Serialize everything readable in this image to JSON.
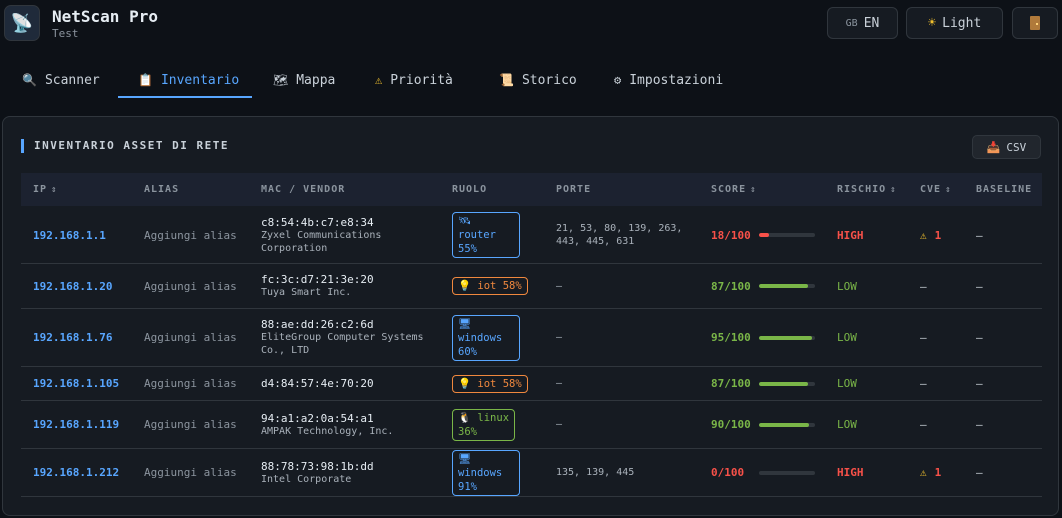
{
  "app": {
    "title": "NetScan Pro",
    "subtitle": "Test",
    "logo_icon": "satellite-dish-icon"
  },
  "header_buttons": {
    "lang_flag": "GB",
    "lang_label": "EN",
    "theme_label": "Light",
    "exit_icon": "door-icon"
  },
  "tabs": [
    {
      "label": "Scanner",
      "icon": "🔍"
    },
    {
      "label": "Inventario",
      "icon": "📋",
      "active": true
    },
    {
      "label": "Mappa",
      "icon": "🗺"
    },
    {
      "label": "Priorità",
      "icon": "⚠"
    },
    {
      "label": "Storico",
      "icon": "📜"
    },
    {
      "label": "Impostazioni",
      "icon": "⚙"
    }
  ],
  "panel": {
    "title": "INVENTARIO ASSET DI RETE",
    "export_label": "CSV"
  },
  "columns": {
    "ip": "IP",
    "alias": "ALIAS",
    "mac": "MAC / VENDOR",
    "role": "RUOLO",
    "ports": "PORTE",
    "score": "SCORE",
    "risk": "RISCHIO",
    "cve": "CVE",
    "baseline": "BASELINE",
    "sort_glyph": "⇕"
  },
  "colors": {
    "accent": "#58a6ff",
    "high": "#f85149",
    "low": "#7ab648",
    "iot": "#f0883e"
  },
  "rows": [
    {
      "ip": "192.168.1.1",
      "alias": "Aggiungi alias",
      "mac": "c8:54:4b:c7:e8:34",
      "vendor_l1": "Zyxel Communications",
      "vendor_l2": "Corporation",
      "role_icon": "🛰",
      "role_l1": "router",
      "role_l2": "55%",
      "ports_l1": "21, 53, 80, 139, 263,",
      "ports_l2": "443, 445, 631",
      "score": "18/100",
      "score_pct": 18,
      "risk": "HIGH",
      "cve_icon": "⚠",
      "cve": "1",
      "baseline": "—"
    },
    {
      "ip": "192.168.1.20",
      "alias": "Aggiungi alias",
      "mac": "fc:3c:d7:21:3e:20",
      "vendor_l1": "Tuya Smart Inc.",
      "vendor_l2": "",
      "role_icon": "💡",
      "role_l1": "iot 58%",
      "role_l2": "",
      "ports_l1": "—",
      "ports_l2": "",
      "score": "87/100",
      "score_pct": 87,
      "risk": "LOW",
      "cve_icon": "",
      "cve": "—",
      "baseline": "—"
    },
    {
      "ip": "192.168.1.76",
      "alias": "Aggiungi alias",
      "mac": "88:ae:dd:26:c2:6d",
      "vendor_l1": "EliteGroup Computer Systems",
      "vendor_l2": "Co., LTD",
      "role_icon": "🖥",
      "role_l1": "windows",
      "role_l2": "60%",
      "ports_l1": "—",
      "ports_l2": "",
      "score": "95/100",
      "score_pct": 95,
      "risk": "LOW",
      "cve_icon": "",
      "cve": "—",
      "baseline": "—"
    },
    {
      "ip": "192.168.1.105",
      "alias": "Aggiungi alias",
      "mac": "d4:84:57:4e:70:20",
      "vendor_l1": "",
      "vendor_l2": "",
      "role_icon": "💡",
      "role_l1": "iot 58%",
      "role_l2": "",
      "ports_l1": "—",
      "ports_l2": "",
      "score": "87/100",
      "score_pct": 87,
      "risk": "LOW",
      "cve_icon": "",
      "cve": "—",
      "baseline": "—"
    },
    {
      "ip": "192.168.1.119",
      "alias": "Aggiungi alias",
      "mac": "94:a1:a2:0a:54:a1",
      "vendor_l1": "AMPAK Technology, Inc.",
      "vendor_l2": "",
      "role_icon": "🐧",
      "role_l1": "linux",
      "role_l2": "36%",
      "ports_l1": "—",
      "ports_l2": "",
      "score": "90/100",
      "score_pct": 90,
      "risk": "LOW",
      "cve_icon": "",
      "cve": "—",
      "baseline": "—"
    },
    {
      "ip": "192.168.1.212",
      "alias": "Aggiungi alias",
      "mac": "88:78:73:98:1b:dd",
      "vendor_l1": "Intel Corporate",
      "vendor_l2": "",
      "role_icon": "🖥",
      "role_l1": "windows",
      "role_l2": "91%",
      "ports_l1": "135, 139, 445",
      "ports_l2": "",
      "score": "0/100",
      "score_pct": 0,
      "risk": "HIGH",
      "cve_icon": "⚠",
      "cve": "1",
      "baseline": "—"
    }
  ]
}
